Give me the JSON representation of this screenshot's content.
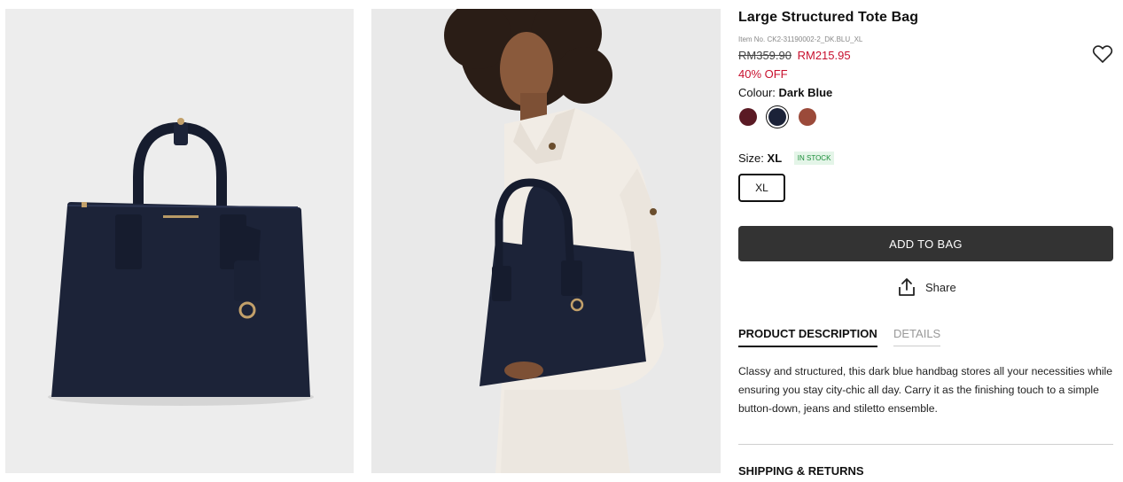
{
  "product": {
    "title": "Large Structured Tote Bag",
    "item_no": "Item No. CK2-31190002-2_DK.BLU_XL",
    "price_original": "RM359.90",
    "price_sale": "RM215.95",
    "discount": "40% OFF",
    "colour_label": "Colour:",
    "colour_value": "Dark Blue",
    "swatches": [
      {
        "name": "burgundy",
        "color": "#5a1a24"
      },
      {
        "name": "dark-blue",
        "color": "#1b2238",
        "selected": true
      },
      {
        "name": "rust",
        "color": "#9b4a3a"
      }
    ],
    "size_label": "Size:",
    "size_value": "XL",
    "stock_status": "IN STOCK",
    "size_option": "XL"
  },
  "actions": {
    "add_to_bag": "ADD TO BAG",
    "share": "Share",
    "wishlist_icon": "heart-outline-icon",
    "share_icon": "share-upload-icon"
  },
  "tabs": {
    "description": "PRODUCT DESCRIPTION",
    "details": "DETAILS"
  },
  "description": "Classy and structured, this dark blue handbag stores all your necessities while ensuring you stay city-chic all day. Carry it as the finishing touch to a simple button-down, jeans and stiletto ensemble.",
  "shipping": "SHIPPING & RETURNS",
  "colors": {
    "bag_navy": "#1c2338",
    "sale_red": "#c8102e",
    "button_dark": "#333333",
    "stock_green": "#1b8e3a"
  }
}
